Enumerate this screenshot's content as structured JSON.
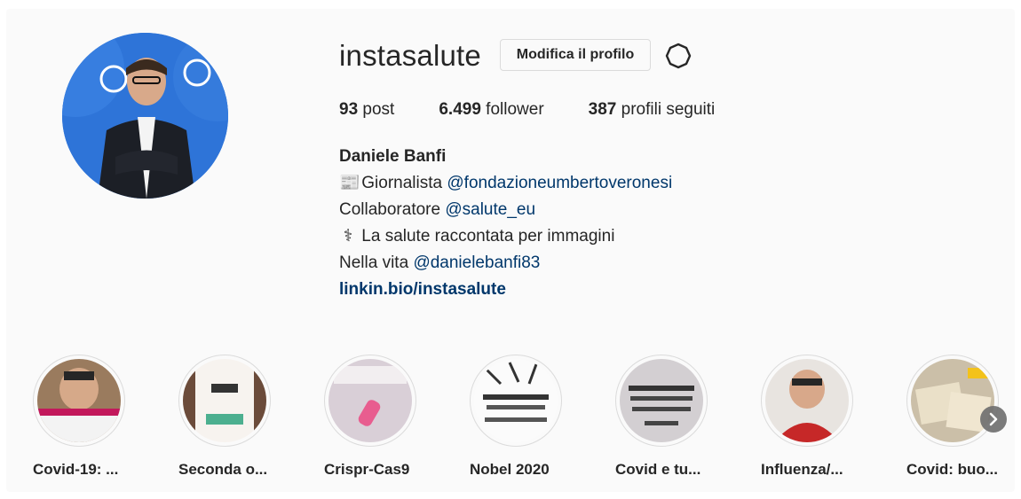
{
  "profile": {
    "username": "instasalute",
    "edit_button_label": "Modifica il profilo",
    "stats": {
      "posts_count": "93",
      "posts_label": "post",
      "followers_count": "6.499",
      "followers_label": "follower",
      "following_count": "387",
      "following_label": "profili seguiti"
    },
    "bio": {
      "full_name": "Daniele Banfi",
      "line1_emoji": "📰",
      "line1_text": "Giornalista",
      "line1_mention": "@fondazioneumbertoveronesi",
      "line2_text": "Collaboratore",
      "line2_mention": "@salute_eu",
      "line3_emoji": "⚕",
      "line3_text": "La salute raccontata per immagini",
      "line4_text": "Nella vita",
      "line4_mention": "@danielebanfi83",
      "link": "linkin.bio/instasalute"
    }
  },
  "highlights": [
    {
      "label": "Covid-19: ..."
    },
    {
      "label": "Seconda o..."
    },
    {
      "label": "Crispr-Cas9"
    },
    {
      "label": "Nobel 2020"
    },
    {
      "label": "Covid e tu..."
    },
    {
      "label": "Influenza/..."
    },
    {
      "label": "Covid: buo..."
    }
  ],
  "icons": {
    "settings": "gear-icon",
    "next": "chevron-right-icon"
  },
  "colors": {
    "link": "#00376b",
    "avatar_background": "#2e74d8"
  }
}
